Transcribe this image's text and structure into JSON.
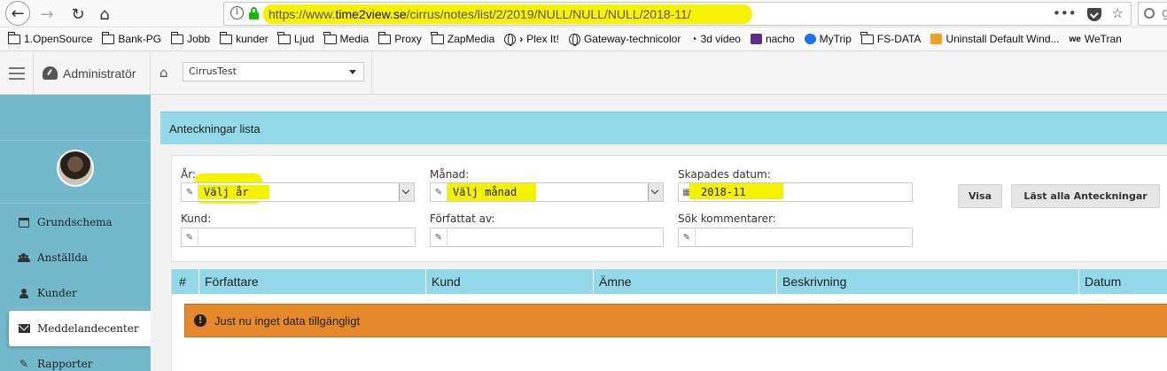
{
  "browser": {
    "url_scheme": "https://www.",
    "url_domain": "time2view.se",
    "url_path": "/cirrus/notes/list/2/2019/NULL/NULL/NULL/2018-11/",
    "search_fragment": "g",
    "bookmarks": [
      {
        "label": "1.OpenSource",
        "icon": "folder-icon"
      },
      {
        "label": "Bank-PG",
        "icon": "folder-icon"
      },
      {
        "label": "Jobb",
        "icon": "folder-icon"
      },
      {
        "label": "kunder",
        "icon": "folder-icon"
      },
      {
        "label": "Ljud",
        "icon": "folder-icon"
      },
      {
        "label": "Media",
        "icon": "folder-icon"
      },
      {
        "label": "Proxy",
        "icon": "folder-icon"
      },
      {
        "label": "ZapMedia",
        "icon": "folder-icon"
      },
      {
        "label": "Plex It!",
        "icon": "globe-icon"
      },
      {
        "label": "Gateway-technicolor",
        "icon": "globe-icon"
      },
      {
        "label": "3d video",
        "icon": "signal-icon"
      },
      {
        "label": "nacho",
        "icon": "mail-icon"
      },
      {
        "label": "MyTrip",
        "icon": "a-icon"
      },
      {
        "label": "FS-DATA",
        "icon": "folder-icon"
      },
      {
        "label": "Uninstall Default Wind...",
        "icon": "install-icon"
      },
      {
        "label": "WeTran",
        "icon": "we-icon"
      }
    ]
  },
  "header": {
    "admin_label": "Administratör",
    "client_select": "CirrusTest"
  },
  "sidebar": {
    "items": [
      {
        "label": "Grundschema",
        "icon": "calendar-icon"
      },
      {
        "label": "Anställda",
        "icon": "users-icon"
      },
      {
        "label": "Kunder",
        "icon": "user-icon"
      },
      {
        "label": "Meddelandecenter",
        "icon": "envelope-icon"
      },
      {
        "label": "Rapporter",
        "icon": "pencil-icon"
      }
    ]
  },
  "panel": {
    "title": "Anteckningar lista"
  },
  "filters": {
    "year_label": "År:",
    "year_value": "Välj år",
    "month_label": "Månad:",
    "month_value": "Välj månad",
    "created_label": "Skapades datum:",
    "created_value": "2018-11",
    "customer_label": "Kund:",
    "customer_value": "",
    "author_label": "Författat av:",
    "author_value": "",
    "comment_label": "Sök kommentarer:",
    "comment_value": "",
    "show_button": "Visa",
    "read_all_button": "Läst alla Anteckningar"
  },
  "table": {
    "columns": [
      "#",
      "Författare",
      "Kund",
      "Ämne",
      "Beskrivning",
      "Datum"
    ],
    "empty_message": "Just nu inget data tillgängligt"
  },
  "colors": {
    "highlight": "#f5f200",
    "panel_header": "#94d9e9",
    "sidebar": "#74b8cc",
    "alert": "#e6892c",
    "lock_green": "#12bc00"
  }
}
